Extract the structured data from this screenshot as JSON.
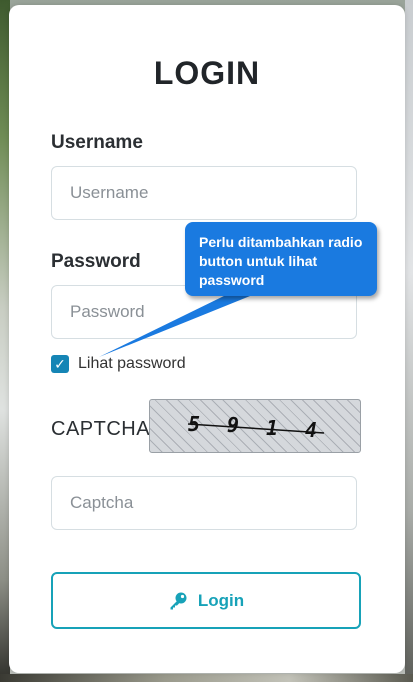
{
  "form": {
    "title": "LOGIN",
    "username_label": "Username",
    "username_placeholder": "Username",
    "username_value": "",
    "password_label": "Password",
    "password_placeholder": "Password",
    "password_value": "",
    "show_password_label": "Lihat password",
    "show_password_checked": true,
    "captcha_label": "CAPTCHA",
    "captcha_text": "5914",
    "captcha_placeholder": "Captcha",
    "captcha_value": "",
    "login_label": "Login",
    "login_icon": "key-icon"
  },
  "annotation": {
    "text": "Perlu ditambahkan radio button untuk lihat password"
  },
  "colors": {
    "accent": "#17a2b8",
    "checkbox": "#1585b5",
    "tooltip": "#1a7ae0"
  }
}
